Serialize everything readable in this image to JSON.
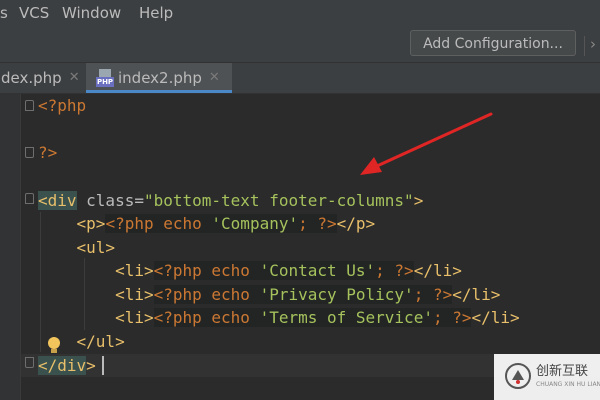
{
  "menu": {
    "items": [
      {
        "label": "s"
      },
      {
        "label": "VCS"
      },
      {
        "label": "Window"
      },
      {
        "label": "Help"
      }
    ]
  },
  "toolbar": {
    "config_label": "Add Configuration...",
    "overflow_icon": "chevron-right-icon"
  },
  "tabs": [
    {
      "label": "dex.php",
      "close": "✕",
      "active": false
    },
    {
      "label": "index2.php",
      "close": "✕",
      "active": true,
      "icon": "php-file-icon",
      "icon_badge": "PHP"
    }
  ],
  "editor": {
    "lines": [
      {
        "tokens": [
          {
            "t": "<?php",
            "c": "php"
          }
        ]
      },
      {
        "tokens": []
      },
      {
        "tokens": [
          {
            "t": "?>",
            "c": "php"
          }
        ]
      },
      {
        "tokens": []
      },
      {
        "tokens": [
          {
            "t": "<div",
            "c": "tag",
            "match": true
          },
          {
            "t": " class=",
            "c": "attr"
          },
          {
            "t": "\"bottom-text footer-columns\"",
            "c": "str"
          },
          {
            "t": ">",
            "c": "tag"
          }
        ]
      },
      {
        "tokens": [
          {
            "t": "    "
          },
          {
            "t": "<p>",
            "c": "tag"
          },
          {
            "t": "<?php",
            "c": "php",
            "embed": true
          },
          {
            "t": " echo ",
            "c": "php",
            "embed": true
          },
          {
            "t": "'Company'",
            "c": "str",
            "embed": true
          },
          {
            "t": "; ",
            "c": "php",
            "embed": true
          },
          {
            "t": "?>",
            "c": "php",
            "embed": true
          },
          {
            "t": "</p>",
            "c": "tag"
          }
        ]
      },
      {
        "tokens": [
          {
            "t": "    "
          },
          {
            "t": "<ul>",
            "c": "tag"
          }
        ]
      },
      {
        "tokens": [
          {
            "t": "        "
          },
          {
            "t": "<li>",
            "c": "tag"
          },
          {
            "t": "<?php",
            "c": "php",
            "embed": true
          },
          {
            "t": " echo ",
            "c": "php",
            "embed": true
          },
          {
            "t": "'Contact Us'",
            "c": "str",
            "embed": true
          },
          {
            "t": "; ",
            "c": "php",
            "embed": true
          },
          {
            "t": "?>",
            "c": "php",
            "embed": true
          },
          {
            "t": "</li>",
            "c": "tag"
          }
        ]
      },
      {
        "tokens": [
          {
            "t": "        "
          },
          {
            "t": "<li>",
            "c": "tag"
          },
          {
            "t": "<?php",
            "c": "php",
            "embed": true
          },
          {
            "t": " echo ",
            "c": "php",
            "embed": true
          },
          {
            "t": "'Privacy Policy'",
            "c": "str",
            "embed": true
          },
          {
            "t": "; ",
            "c": "php",
            "embed": true
          },
          {
            "t": "?>",
            "c": "php",
            "embed": true
          },
          {
            "t": "</li>",
            "c": "tag"
          }
        ]
      },
      {
        "tokens": [
          {
            "t": "        "
          },
          {
            "t": "<li>",
            "c": "tag"
          },
          {
            "t": "<?php",
            "c": "php",
            "embed": true
          },
          {
            "t": " echo ",
            "c": "php",
            "embed": true
          },
          {
            "t": "'Terms of Service'",
            "c": "str",
            "embed": true
          },
          {
            "t": "; ",
            "c": "php",
            "embed": true
          },
          {
            "t": "?>",
            "c": "php",
            "embed": true
          },
          {
            "t": "</li>",
            "c": "tag"
          }
        ]
      },
      {
        "tokens": [
          {
            "t": "    "
          },
          {
            "t": "</ul>",
            "c": "tag"
          }
        ]
      },
      {
        "tokens": [
          {
            "t": "</div",
            "c": "tag",
            "match": true
          },
          {
            "t": ">",
            "c": "tag"
          }
        ]
      }
    ],
    "intention_icon": "lightbulb-icon"
  },
  "annotation": {
    "arrow_icon": "red-arrow-icon",
    "color": "#e02525"
  },
  "watermark": {
    "text_cn": "创新互联",
    "text_en": "CHUANG XIN HU LIAN"
  },
  "colors": {
    "php_keyword": "#cc7832",
    "html_tag": "#e8bf6a",
    "string": "#a5c25c",
    "attribute": "#bababa",
    "background": "#2b2b2b",
    "active_tab_underline": "#4a88c7"
  }
}
